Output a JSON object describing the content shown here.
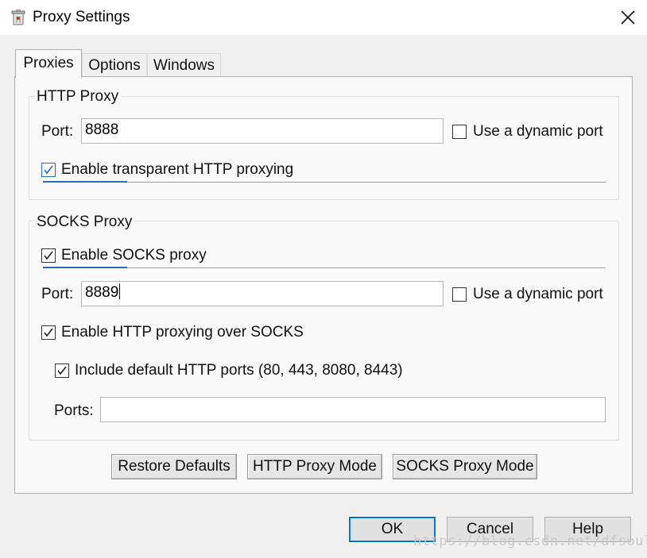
{
  "window": {
    "title": "Proxy Settings",
    "close_icon": "close-icon",
    "app_icon": "trash-can-icon"
  },
  "tabs": [
    {
      "label": "Proxies",
      "active": true
    },
    {
      "label": "Options",
      "active": false
    },
    {
      "label": "Windows",
      "active": false
    }
  ],
  "http_proxy": {
    "legend": "HTTP Proxy",
    "port_label": "Port:",
    "port_value": "8888",
    "dynamic_port_label": "Use a dynamic port",
    "dynamic_port_checked": false,
    "transparent_label": "Enable transparent HTTP proxying",
    "transparent_checked": true
  },
  "socks_proxy": {
    "legend": "SOCKS Proxy",
    "enable_label": "Enable SOCKS proxy",
    "enable_checked": true,
    "port_label": "Port:",
    "port_value": "8889",
    "dynamic_port_label": "Use a dynamic port",
    "dynamic_port_checked": false,
    "http_over_socks_label": "Enable HTTP proxying over SOCKS",
    "http_over_socks_checked": true,
    "include_default_label": "Include default HTTP ports (80, 443, 8080, 8443)",
    "include_default_checked": true,
    "ports_label": "Ports:",
    "ports_value": ""
  },
  "mode_buttons": {
    "restore": "Restore Defaults",
    "http_mode": "HTTP Proxy Mode",
    "socks_mode": "SOCKS Proxy Mode"
  },
  "dialog_buttons": {
    "ok": "OK",
    "cancel": "Cancel",
    "help": "Help"
  },
  "watermark": "https://blog.csdn.net/dfsoul",
  "colors": {
    "accent": "#0078d7",
    "check": "#2a6ab8",
    "panel": "#f9f9f9",
    "background": "#f0f0f0"
  }
}
